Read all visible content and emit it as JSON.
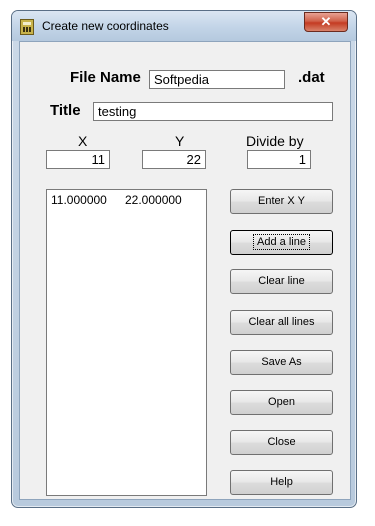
{
  "window": {
    "title": "Create new coordinates",
    "close_glyph": "✕"
  },
  "file": {
    "label": "File Name",
    "value": "Softpedia",
    "extension": ".dat"
  },
  "title_field": {
    "label": "Title",
    "value": "testing"
  },
  "columns": {
    "x_label": "X",
    "y_label": "Y",
    "divide_label": "Divide by"
  },
  "inputs": {
    "x_value": "11",
    "y_value": "22",
    "divide_value": "1"
  },
  "list": {
    "rows": [
      {
        "x": "11.000000",
        "y": "22.000000"
      }
    ]
  },
  "buttons": {
    "enter_xy": "Enter X Y",
    "add_line": "Add a line",
    "clear_line": "Clear line",
    "clear_all": "Clear all lines",
    "save_as": "Save As",
    "open": "Open",
    "close": "Close",
    "help": "Help"
  },
  "icons": {
    "app": "app-icon",
    "close": "close-icon"
  }
}
